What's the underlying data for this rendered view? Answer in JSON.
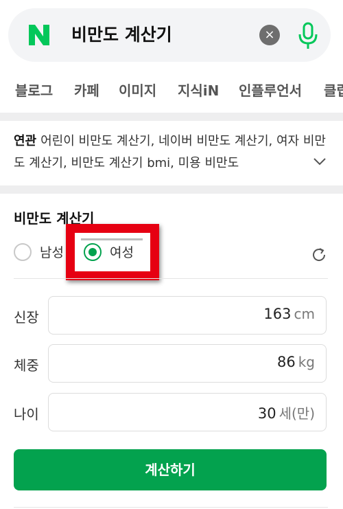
{
  "search": {
    "query": "비만도 계산기",
    "clear_label": "×"
  },
  "tabs": [
    "블로그",
    "카페",
    "이미지",
    "지식iN",
    "인플루언서",
    "클립"
  ],
  "related": {
    "label": "연관",
    "text": "어린이 비만도 계산기, 네이버 비만도 계산기, 여자 비만도 계산기, 비만도 계산기 bmi, 미용 비만도"
  },
  "calculator": {
    "title": "비만도 계산기",
    "gender_options": [
      {
        "label": "남성",
        "selected": false
      },
      {
        "label": "여성",
        "selected": true
      }
    ],
    "fields": [
      {
        "label": "신장",
        "value": "163",
        "unit": "cm"
      },
      {
        "label": "체중",
        "value": "86",
        "unit": "kg"
      },
      {
        "label": "나이",
        "value": "30",
        "unit": "세(만)"
      }
    ],
    "button_label": "계산하기"
  },
  "colors": {
    "accent": "#03a24e",
    "highlight": "#e60012"
  }
}
